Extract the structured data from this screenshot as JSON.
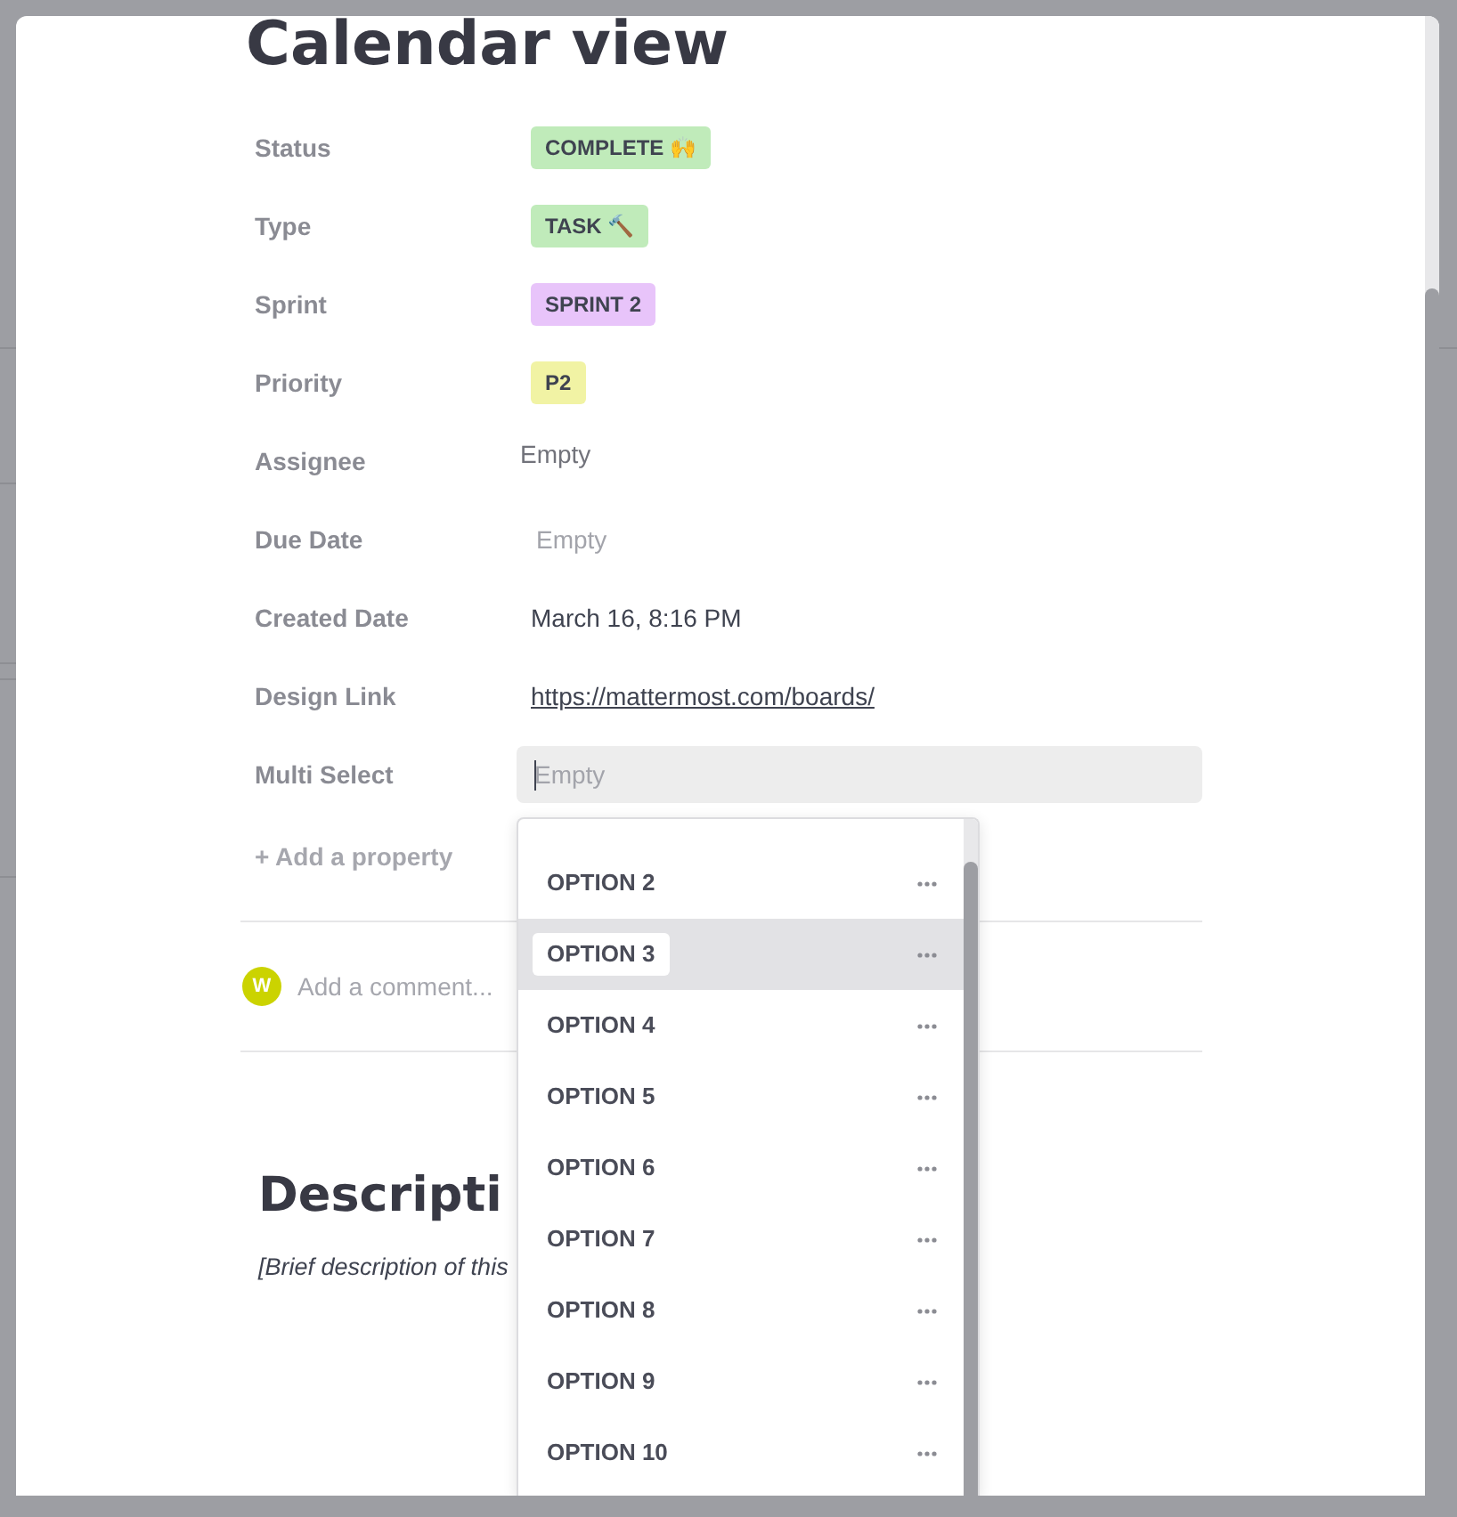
{
  "dialog": {
    "title": "Calendar view",
    "properties": [
      {
        "label": "Status",
        "kind": "tag",
        "value": "COMPLETE 🙌",
        "color": "#c0ebba"
      },
      {
        "label": "Type",
        "kind": "tag",
        "value": "TASK 🔨",
        "color": "#c0ebba"
      },
      {
        "label": "Sprint",
        "kind": "tag",
        "value": "SPRINT 2",
        "color": "#e8c4fa"
      },
      {
        "label": "Priority",
        "kind": "tag",
        "value": "P2",
        "color": "#f1f3a4"
      },
      {
        "label": "Assignee",
        "kind": "person",
        "placeholder": "Empty"
      },
      {
        "label": "Due Date",
        "kind": "date",
        "placeholder": "Empty"
      },
      {
        "label": "Created Date",
        "kind": "text",
        "value": "March 16, 8:16 PM"
      },
      {
        "label": "Design Link",
        "kind": "link",
        "value": "https://mattermost.com/boards/"
      },
      {
        "label": "Multi Select",
        "kind": "multi_select",
        "placeholder": "Empty",
        "focused": true
      }
    ],
    "add_property": "+ Add a property",
    "comment": {
      "avatar": "W",
      "placeholder": "Add a comment..."
    },
    "description": {
      "heading": "Descripti",
      "text": "[Brief description of this"
    }
  },
  "dropdown": {
    "options": [
      {
        "label": "OPTION 2",
        "selected": false
      },
      {
        "label": "OPTION 3",
        "selected": true
      },
      {
        "label": "OPTION 4",
        "selected": false
      },
      {
        "label": "OPTION 5",
        "selected": false
      },
      {
        "label": "OPTION 6",
        "selected": false
      },
      {
        "label": "OPTION 7",
        "selected": false
      },
      {
        "label": "OPTION 8",
        "selected": false
      },
      {
        "label": "OPTION 9",
        "selected": false
      },
      {
        "label": "OPTION 10",
        "selected": false
      }
    ]
  }
}
